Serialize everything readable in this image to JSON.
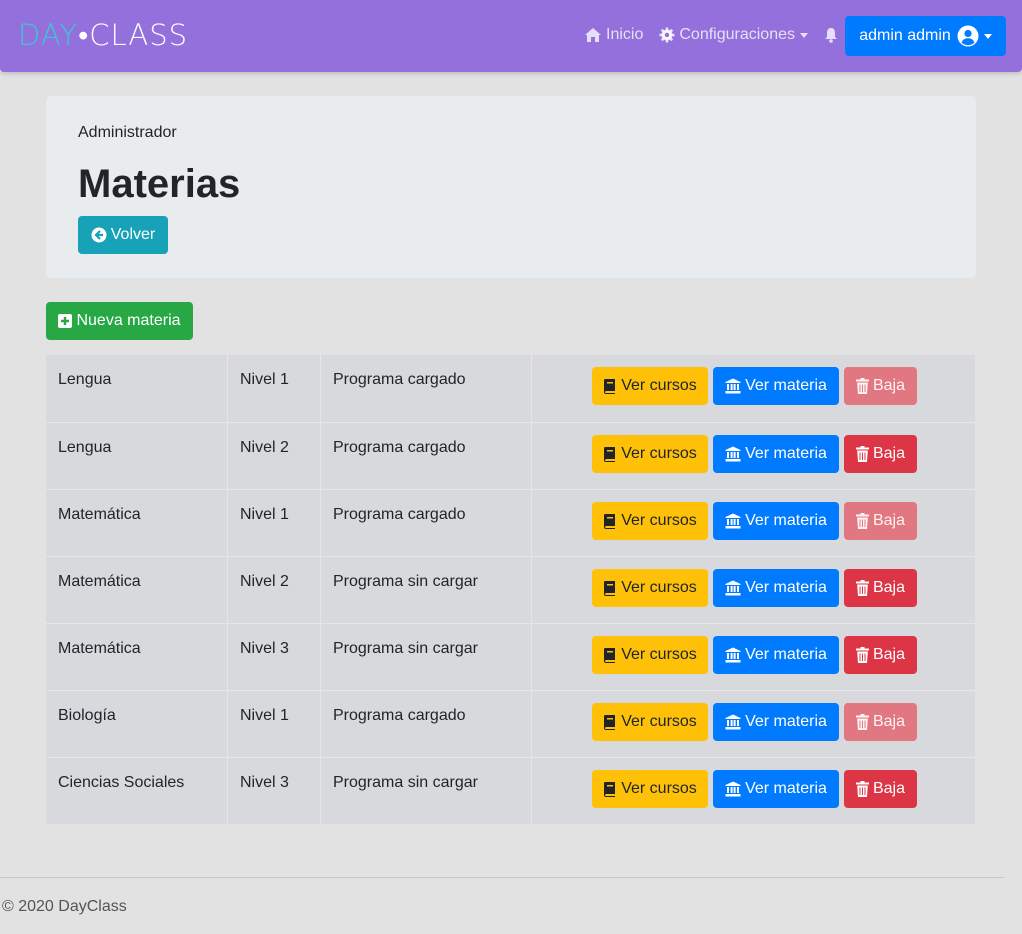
{
  "navbar": {
    "brand_day": "DAY",
    "brand_dot": "•",
    "brand_class": "CLASS",
    "home_label": "Inicio",
    "config_label": "Configuraciones",
    "user_label": "admin admin"
  },
  "header": {
    "role": "Administrador",
    "title": "Materias",
    "back_label": "Volver"
  },
  "actions": {
    "new_label": "Nueva materia"
  },
  "row_buttons": {
    "cursos": "Ver cursos",
    "materia": "Ver materia",
    "baja": "Baja"
  },
  "rows": [
    {
      "name": "Lengua",
      "level": "Nivel 1",
      "status": "Programa cargado",
      "baja_disabled": true
    },
    {
      "name": "Lengua",
      "level": "Nivel 2",
      "status": "Programa cargado",
      "baja_disabled": false
    },
    {
      "name": "Matemática",
      "level": "Nivel 1",
      "status": "Programa cargado",
      "baja_disabled": true
    },
    {
      "name": "Matemática",
      "level": "Nivel 2",
      "status": "Programa sin cargar",
      "baja_disabled": false
    },
    {
      "name": "Matemática",
      "level": "Nivel 3",
      "status": "Programa sin cargar",
      "baja_disabled": false
    },
    {
      "name": "Biología",
      "level": "Nivel 1",
      "status": "Programa cargado",
      "baja_disabled": true
    },
    {
      "name": "Ciencias Sociales",
      "level": "Nivel 3",
      "status": "Programa sin cargar",
      "baja_disabled": false
    }
  ],
  "footer": {
    "text": "© 2020 DayClass"
  },
  "colors": {
    "navbar": "#9370db",
    "primary": "#007bff",
    "info": "#17a2b8",
    "success": "#28a745",
    "warning": "#ffc107",
    "danger": "#dc3545"
  },
  "icons": {
    "home": "home-icon",
    "config": "gear-icon",
    "bell": "bell-icon",
    "user": "user-circle-icon",
    "back": "arrow-circle-left-icon",
    "new": "plus-square-icon",
    "cursos": "book-icon",
    "materia": "university-icon",
    "baja": "trash-icon"
  }
}
